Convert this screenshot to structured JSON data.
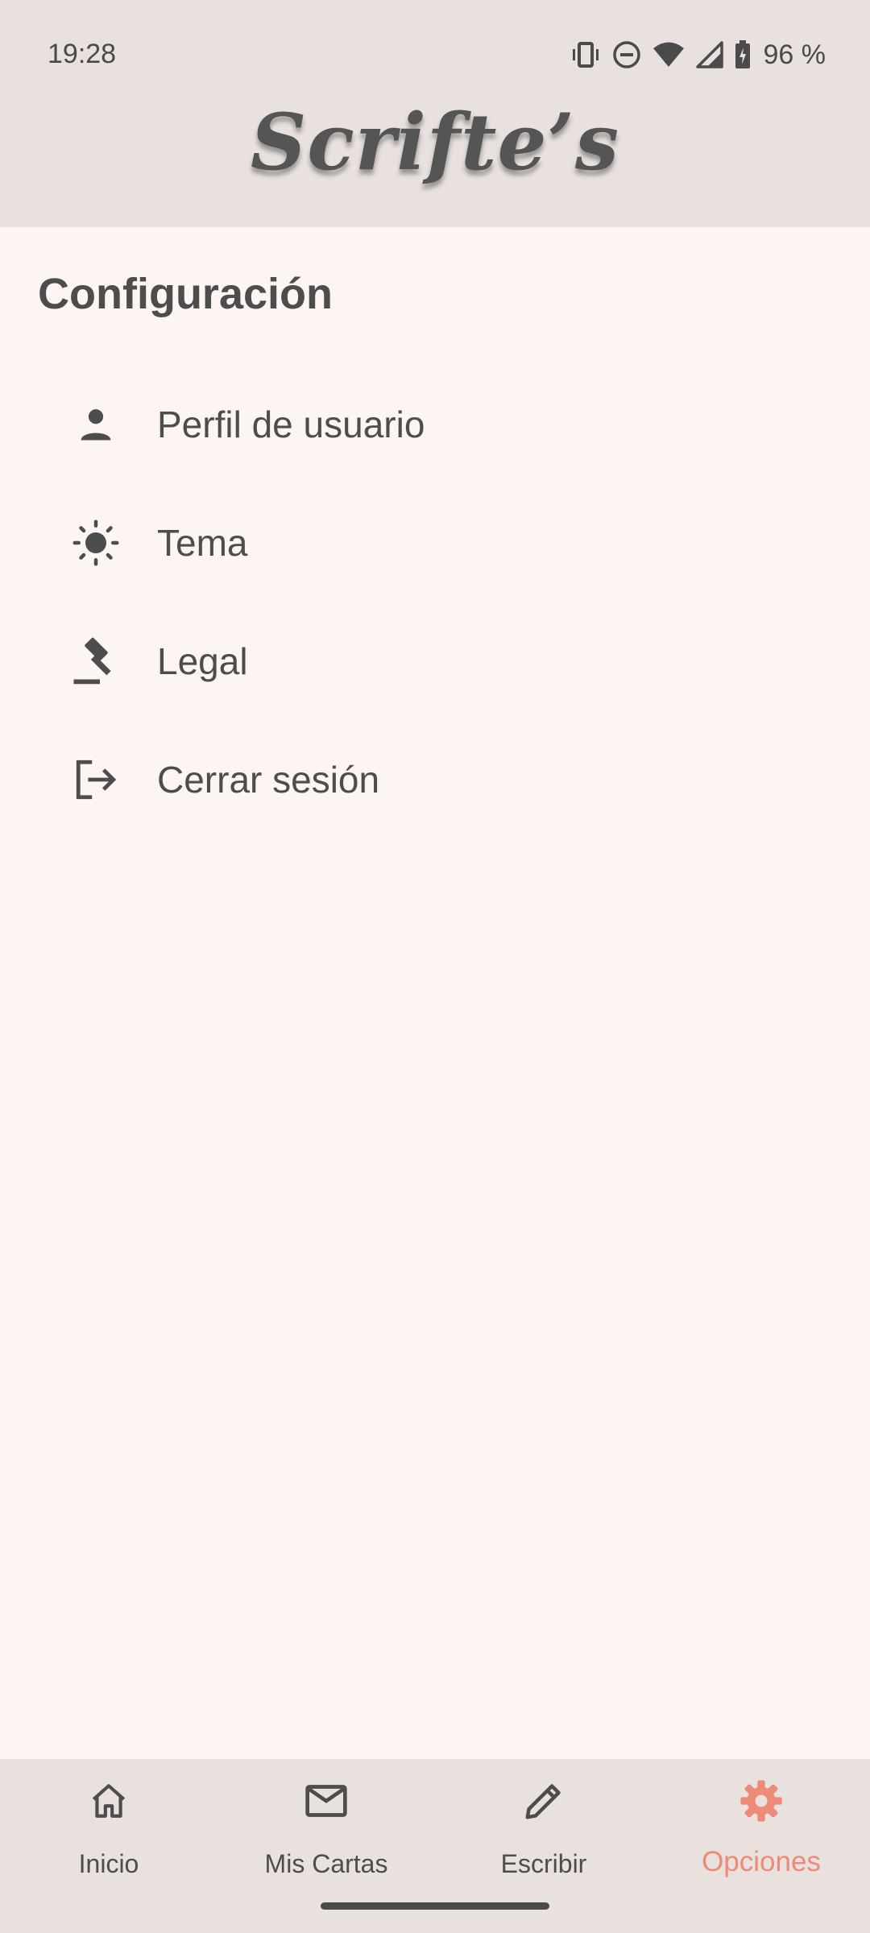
{
  "status_bar": {
    "time": "19:28",
    "battery_text": "96 %",
    "icons": [
      "vibrate-icon",
      "do-not-disturb-icon",
      "wifi-icon",
      "signal-icon",
      "battery-icon"
    ]
  },
  "app": {
    "title": "Scrifte’s"
  },
  "settings": {
    "title": "Configuración",
    "items": [
      {
        "label": "Perfil de usuario",
        "icon": "person-icon"
      },
      {
        "label": "Tema",
        "icon": "sun-icon"
      },
      {
        "label": "Legal",
        "icon": "gavel-icon"
      },
      {
        "label": "Cerrar sesión",
        "icon": "logout-icon"
      }
    ]
  },
  "bottom_nav": {
    "items": [
      {
        "label": "Inicio",
        "icon": "home-icon"
      },
      {
        "label": "Mis Cartas",
        "icon": "mail-icon"
      },
      {
        "label": "Escribir",
        "icon": "pencil-icon"
      },
      {
        "label": "Opciones",
        "icon": "gear-icon",
        "active": true
      }
    ]
  },
  "colors": {
    "header_bg": "#e8e1dd",
    "page_bg": "#fcf5f1",
    "text": "#4d4d4d",
    "accent": "#ee8a78"
  }
}
